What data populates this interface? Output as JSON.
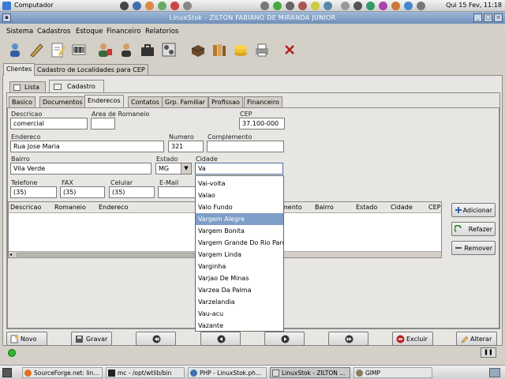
{
  "top_panel": {
    "menu": "Computador",
    "clock": "Qui 15 Fev, 11:18"
  },
  "window": {
    "title": "LinuxStok - ZILTON FABIANO DE MIRANDA JUNIOR"
  },
  "menu": [
    "Sistema",
    "Cadastros",
    "Estoque",
    "Financeiro",
    "Relatorios"
  ],
  "main_tabs": [
    "Clientes",
    "Cadastro de Localidades para CEP"
  ],
  "view_tabs": [
    "Lista",
    "Cadastro"
  ],
  "section_tabs": [
    "Basico",
    "Documentos",
    "Enderecos",
    "Contatos",
    "Grp. Familiar",
    "Profissao",
    "Financeiro"
  ],
  "form": {
    "descricao_label": "Descricao",
    "descricao_value": "comercial",
    "area_label": "Area de Romaneio",
    "area_value": "",
    "cep_label": "CEP",
    "cep_value": "37.100-000",
    "endereco_label": "Endereco",
    "endereco_value": "Rua Jose Maria",
    "numero_label": "Numero",
    "numero_value": "321",
    "complemento_label": "Complemento",
    "complemento_value": "",
    "bairro_label": "Bairro",
    "bairro_value": "Vila Verde",
    "estado_label": "Estado",
    "estado_value": "MG",
    "cidade_label": "Cidade",
    "cidade_value": "Va",
    "telefone_label": "Telefone",
    "telefone_value": "(35)",
    "fax_label": "FAX",
    "fax_value": "(35)",
    "celular_label": "Celular",
    "celular_value": "(35)",
    "email_label": "E-Mail",
    "email_value": ""
  },
  "grid": {
    "columns": [
      "Descricao",
      "Romaneio",
      "Endereco",
      "mento",
      "Bairro",
      "Estado",
      "Cidade",
      "CEP"
    ]
  },
  "side_buttons": [
    "Adicionar",
    "Refazer",
    "Remover"
  ],
  "city_options": [
    "Vai-volta",
    "Valao",
    "Valo Fundo",
    "Vargem Alegre",
    "Vargem Bonita",
    "Vargem Grande Do Rio Pardo",
    "Vargem Linda",
    "Varginha",
    "Varjao De Minas",
    "Varzea Da Palma",
    "Varzelandia",
    "Vau-acu",
    "Vazante"
  ],
  "city_highlighted": "Vargem Alegre",
  "bottom_buttons": {
    "novo": "Novo",
    "gravar": "Gravar",
    "excluir": "Excluir",
    "alterar": "Alterar"
  },
  "taskbar": [
    {
      "label": "SourceForge.net: lin...",
      "icon": "firefox-icon"
    },
    {
      "label": "mc - /opt/wtlib/bin",
      "icon": "terminal-icon"
    },
    {
      "label": "PHP - LinuxStok.ph...",
      "icon": "browser-icon"
    },
    {
      "label": "LinuxStok - ZILTON ...",
      "icon": "app-icon"
    },
    {
      "label": "GIMP",
      "icon": "gimp-icon"
    }
  ]
}
